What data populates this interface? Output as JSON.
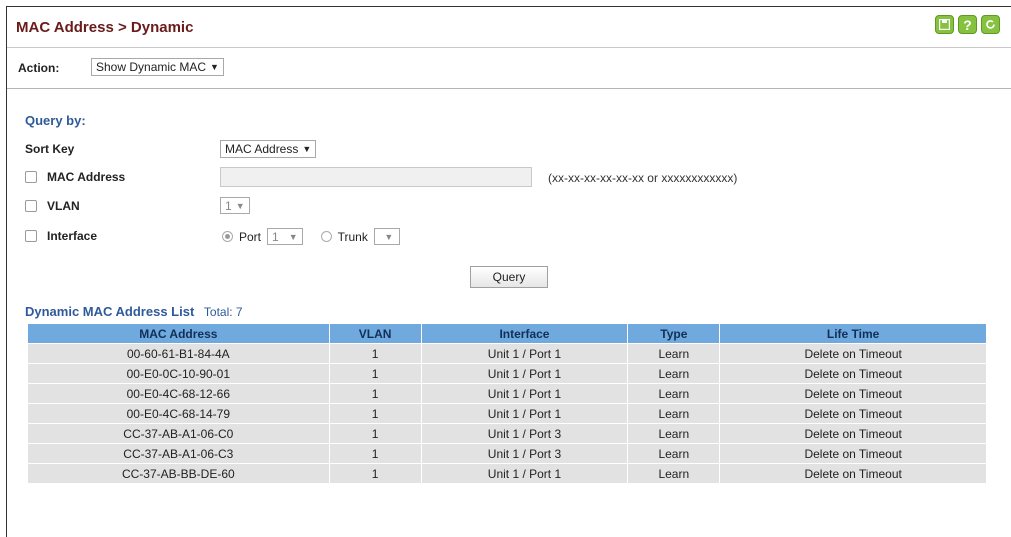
{
  "header": {
    "title": "MAC Address > Dynamic",
    "icons": [
      "save-icon",
      "help-icon",
      "refresh-icon"
    ]
  },
  "action": {
    "label": "Action:",
    "selected": "Show Dynamic MAC"
  },
  "query": {
    "heading": "Query by:",
    "sort_key_label": "Sort Key",
    "sort_key_value": "MAC Address",
    "mac_label": "MAC Address",
    "mac_placeholder": "",
    "mac_hint": "(xx-xx-xx-xx-xx-xx or xxxxxxxxxxxx)",
    "vlan_label": "VLAN",
    "vlan_value": "1",
    "interface_label": "Interface",
    "port_label": "Port",
    "port_value": "1",
    "trunk_label": "Trunk",
    "trunk_value": "",
    "button": "Query"
  },
  "list": {
    "title": "Dynamic MAC Address List",
    "total": "Total: 7",
    "columns": [
      "MAC Address",
      "VLAN",
      "Interface",
      "Type",
      "Life Time"
    ],
    "rows": [
      [
        "00-60-61-B1-84-4A",
        "1",
        "Unit 1 / Port 1",
        "Learn",
        "Delete on Timeout"
      ],
      [
        "00-E0-0C-10-90-01",
        "1",
        "Unit 1 / Port 1",
        "Learn",
        "Delete on Timeout"
      ],
      [
        "00-E0-4C-68-12-66",
        "1",
        "Unit 1 / Port 1",
        "Learn",
        "Delete on Timeout"
      ],
      [
        "00-E0-4C-68-14-79",
        "1",
        "Unit 1 / Port 1",
        "Learn",
        "Delete on Timeout"
      ],
      [
        "CC-37-AB-A1-06-C0",
        "1",
        "Unit 1 / Port 3",
        "Learn",
        "Delete on Timeout"
      ],
      [
        "CC-37-AB-A1-06-C3",
        "1",
        "Unit 1 / Port 3",
        "Learn",
        "Delete on Timeout"
      ],
      [
        "CC-37-AB-BB-DE-60",
        "1",
        "Unit 1 / Port 1",
        "Learn",
        "Delete on Timeout"
      ]
    ]
  },
  "colors": {
    "title": "#6a1b1b",
    "accent": "#2f5a99",
    "table_header": "#6fa9de",
    "table_row": "#e2e2e2",
    "icon_green": "#86c240"
  }
}
